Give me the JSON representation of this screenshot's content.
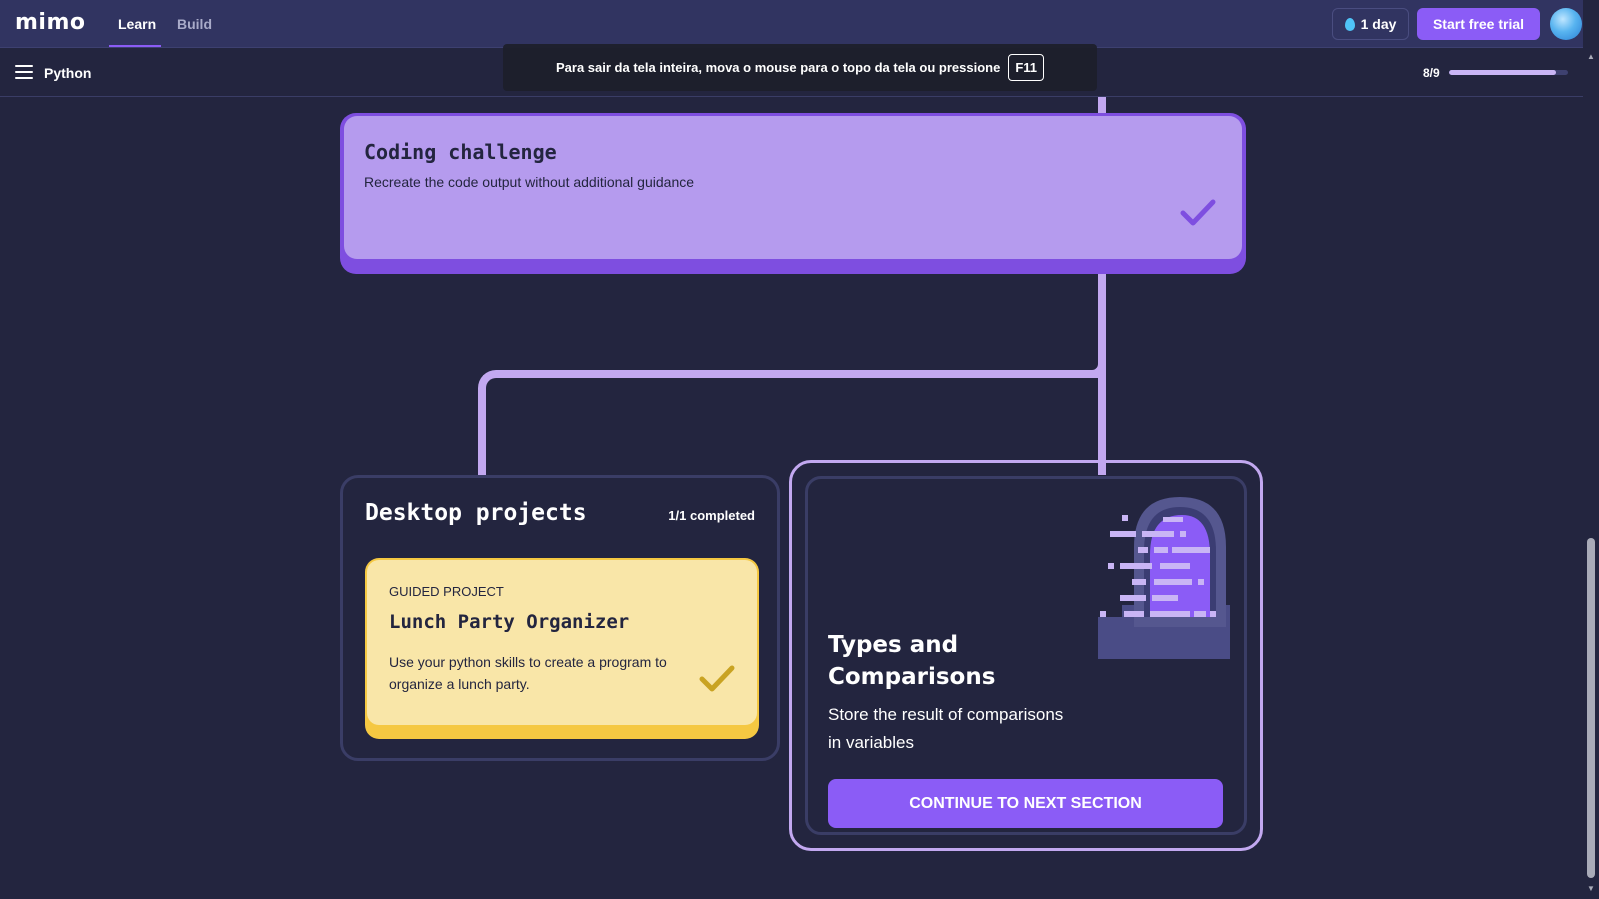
{
  "app": {
    "logo": "mimo",
    "nav_tabs": [
      {
        "label": "Learn",
        "active": true
      },
      {
        "label": "Build",
        "active": false
      }
    ],
    "streak_label": "1 day",
    "trial_button": "Start free trial"
  },
  "subbar": {
    "course": "Python",
    "progress_label": "8/9",
    "progress_fraction": 0.9
  },
  "fullscreen_toast": {
    "message": "Para sair da tela inteira, mova o mouse para o topo da tela ou pressione",
    "key": "F11"
  },
  "challenge": {
    "title": "Coding challenge",
    "description": "Recreate the code output without additional guidance",
    "completed": true
  },
  "projects": {
    "title": "Desktop projects",
    "count": "1/1 completed",
    "card": {
      "tag": "GUIDED PROJECT",
      "title": "Lunch Party Organizer",
      "description": "Use your python skills to create a program to organize a lunch party.",
      "completed": true
    }
  },
  "next_section": {
    "title": "Types and Comparisons",
    "description": "Store the result of comparisons in variables",
    "button": "CONTINUE TO NEXT SECTION"
  },
  "colors": {
    "background": "#23253f",
    "accent": "#8b5cf6",
    "challenge_card": "#b59bee",
    "project_card": "#f9e6a8"
  }
}
